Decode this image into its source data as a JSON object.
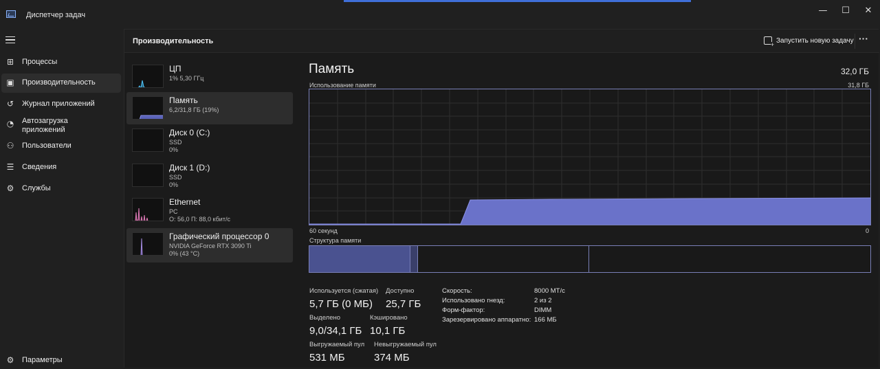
{
  "window": {
    "title": "Диспетчер задач",
    "controls": {
      "minimize": "—",
      "maximize": "☐",
      "close": "✕"
    }
  },
  "nav": {
    "items": [
      {
        "label": "Процессы",
        "icon": "processes-icon"
      },
      {
        "label": "Производительность",
        "icon": "performance-icon",
        "active": true
      },
      {
        "label": "Журнал приложений",
        "icon": "history-icon"
      },
      {
        "label": "Автозагрузка приложений",
        "icon": "startup-icon"
      },
      {
        "label": "Пользователи",
        "icon": "users-icon"
      },
      {
        "label": "Сведения",
        "icon": "details-icon"
      },
      {
        "label": "Службы",
        "icon": "services-icon"
      }
    ],
    "settings": {
      "label": "Параметры",
      "icon": "gear-icon"
    }
  },
  "header": {
    "title": "Производительность",
    "run_task": "Запустить новую задачу",
    "more": "···"
  },
  "devices": [
    {
      "name": "ЦП",
      "line1": "1% 5,30 ГГц",
      "line2": "",
      "color": "#4fc3f7"
    },
    {
      "name": "Память",
      "line1": "6,2/31,8 ГБ (19%)",
      "line2": "",
      "color": "#7b83e0",
      "active": true
    },
    {
      "name": "Диск 0 (C:)",
      "line1": "SSD",
      "line2": "0%",
      "color": "#5cc18a"
    },
    {
      "name": "Диск 1 (D:)",
      "line1": "SSD",
      "line2": "0%",
      "color": "#5cc18a"
    },
    {
      "name": "Ethernet",
      "line1": "PC",
      "line2": "О: 56,0 П: 88,0 кбит/с",
      "color": "#e07bb8"
    },
    {
      "name": "Графический процессор 0",
      "line1": "NVIDIA GeForce RTX 3090 Ti",
      "line2": "0% (43 °C)",
      "color": "#a48be0"
    }
  ],
  "memory": {
    "title": "Память",
    "total": "32,0 ГБ",
    "usage_label": "Использование памяти",
    "usage_max": "31,8 ГБ",
    "axis_left": "60 секунд",
    "axis_right": "0",
    "structure_label": "Структура памяти",
    "graph_color": "#6a72c9",
    "stats": {
      "in_use_label": "Используется (сжатая)",
      "in_use_value": "5,7 ГБ (0 МБ)",
      "available_label": "Доступно",
      "available_value": "25,7 ГБ",
      "committed_label": "Выделено",
      "committed_value": "9,0/34,1 ГБ",
      "cached_label": "Кэшировано",
      "cached_value": "10,1 ГБ",
      "paged_label": "Выгружаемый пул",
      "paged_value": "531 МБ",
      "nonpaged_label": "Невыгружаемый пул",
      "nonpaged_value": "374 МБ"
    },
    "specs": [
      {
        "k": "Скорость:",
        "v": "8000 МТ/с"
      },
      {
        "k": "Использовано гнезд:",
        "v": "2 из 2"
      },
      {
        "k": "Форм-фактор:",
        "v": "DIMM"
      },
      {
        "k": "Зарезервировано аппаратно:",
        "v": "166 МБ"
      }
    ]
  }
}
